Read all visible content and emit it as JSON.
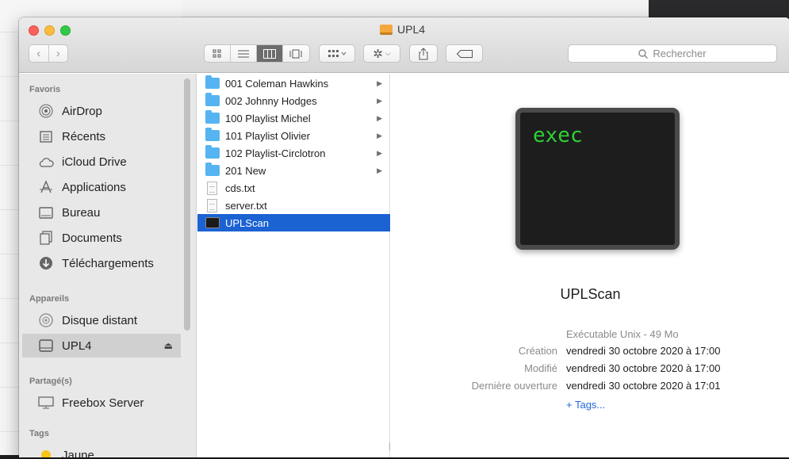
{
  "window": {
    "title": "UPL4"
  },
  "toolbar": {
    "search_placeholder": "Rechercher"
  },
  "sidebar": {
    "sections": [
      {
        "heading": "Favoris"
      },
      {
        "heading": "Appareils"
      },
      {
        "heading": "Partagé(s)"
      },
      {
        "heading": "Tags"
      }
    ],
    "favorites": [
      {
        "label": "AirDrop",
        "icon": "airdrop-icon"
      },
      {
        "label": "Récents",
        "icon": "recents-icon"
      },
      {
        "label": "iCloud Drive",
        "icon": "icloud-icon"
      },
      {
        "label": "Applications",
        "icon": "applications-icon"
      },
      {
        "label": "Bureau",
        "icon": "desktop-icon"
      },
      {
        "label": "Documents",
        "icon": "documents-icon"
      },
      {
        "label": "Téléchargements",
        "icon": "downloads-icon"
      }
    ],
    "devices": [
      {
        "label": "Disque distant",
        "icon": "remote-disk-icon"
      },
      {
        "label": "UPL4",
        "icon": "drive-icon",
        "selected": true
      }
    ],
    "shared": [
      {
        "label": "Freebox Server",
        "icon": "server-icon"
      }
    ],
    "tags": [
      {
        "label": "Jaune",
        "color": "#f5c518"
      }
    ]
  },
  "files": [
    {
      "name": "001 Coleman Hawkins",
      "type": "folder"
    },
    {
      "name": "002 Johnny Hodges",
      "type": "folder"
    },
    {
      "name": "100 Playlist Michel",
      "type": "folder"
    },
    {
      "name": "101 Playlist Olivier",
      "type": "folder"
    },
    {
      "name": "102 Playlist-Circlotron",
      "type": "folder"
    },
    {
      "name": "201 New",
      "type": "folder"
    },
    {
      "name": "cds.txt",
      "type": "text"
    },
    {
      "name": "server.txt",
      "type": "text"
    },
    {
      "name": "UPLScan",
      "type": "exec",
      "selected": true
    }
  ],
  "preview": {
    "icon_text": "exec",
    "name": "UPLScan",
    "kind": "Exécutable Unix - 49 Mo",
    "meta": [
      {
        "label": "Création",
        "value": "vendredi 30 octobre 2020 à 17:00"
      },
      {
        "label": "Modifié",
        "value": "vendredi 30 octobre 2020 à 17:00"
      },
      {
        "label": "Dernière ouverture",
        "value": "vendredi 30 octobre 2020 à 17:01"
      }
    ],
    "tags_link": "+ Tags..."
  },
  "colors": {
    "selection": "#1b62d3",
    "folder": "#55b4f1",
    "terminal_text": "#2cd233",
    "link": "#2466d6"
  }
}
